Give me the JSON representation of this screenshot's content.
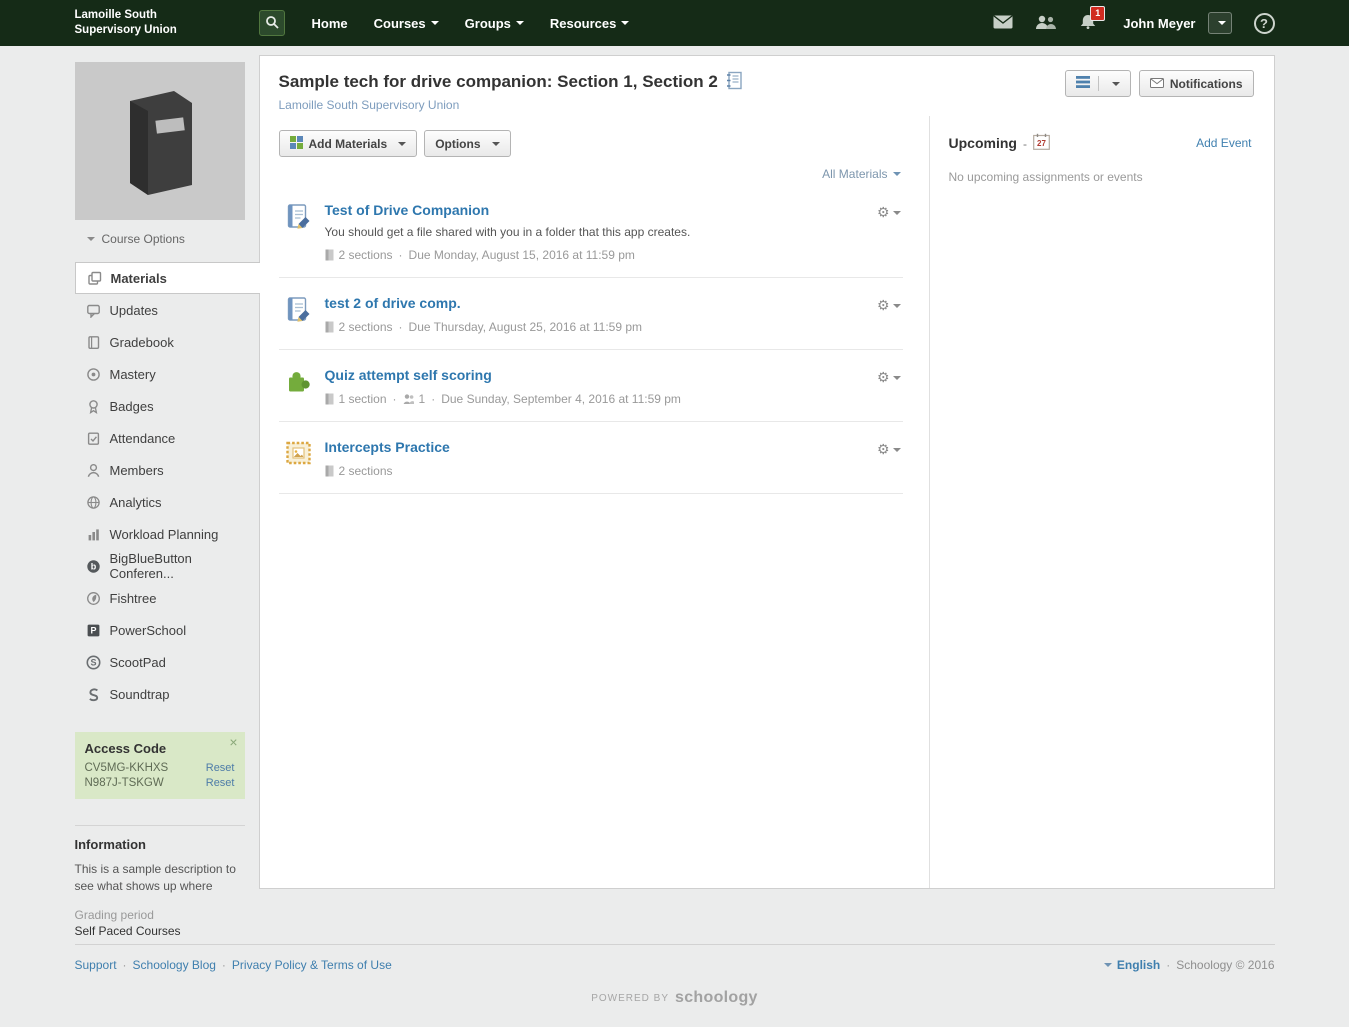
{
  "navbar": {
    "brand_line1": "Lamoille South",
    "brand_line2": "Supervisory Union",
    "links": [
      {
        "label": "Home"
      },
      {
        "label": "Courses"
      },
      {
        "label": "Groups"
      },
      {
        "label": "Resources"
      }
    ],
    "notification_count": "1",
    "user_name": "John Meyer"
  },
  "course_header": {
    "title": "Sample tech for drive companion: Section 1, Section 2",
    "school_link": "Lamoille South Supervisory Union",
    "notifications_label": "Notifications"
  },
  "sidebar": {
    "course_options_label": "Course Options",
    "items": [
      {
        "label": "Materials"
      },
      {
        "label": "Updates"
      },
      {
        "label": "Gradebook"
      },
      {
        "label": "Mastery"
      },
      {
        "label": "Badges"
      },
      {
        "label": "Attendance"
      },
      {
        "label": "Members"
      },
      {
        "label": "Analytics"
      },
      {
        "label": "Workload Planning"
      },
      {
        "label": "BigBlueButton Conferen..."
      },
      {
        "label": "Fishtree"
      },
      {
        "label": "PowerSchool"
      },
      {
        "label": "ScootPad"
      },
      {
        "label": "Soundtrap"
      }
    ],
    "access_code": {
      "title": "Access Code",
      "close_label": "×",
      "codes": [
        {
          "code": "CV5MG-KKHXS",
          "reset_label": "Reset"
        },
        {
          "code": "N987J-TSKGW",
          "reset_label": "Reset"
        }
      ]
    },
    "information": {
      "title": "Information",
      "description": "This is a sample description to see what shows up where",
      "grading_period_label": "Grading period",
      "grading_period_value": "Self Paced Courses"
    }
  },
  "toolbar": {
    "add_materials_label": "Add Materials",
    "options_label": "Options",
    "filter_label": "All Materials"
  },
  "materials": [
    {
      "title": "Test of Drive Companion",
      "description": "You should get a file shared with you in a folder that this app creates.",
      "sections": "2 sections",
      "due": "Due Monday, August 15, 2016 at 11:59 pm"
    },
    {
      "title": "test 2 of drive comp.",
      "sections": "2 sections",
      "due": "Due Thursday, August 25, 2016 at 11:59 pm"
    },
    {
      "title": "Quiz attempt self scoring",
      "sections": "1 section",
      "people_count": "1",
      "due": "Due Sunday, September 4, 2016 at 11:59 pm"
    },
    {
      "title": "Intercepts Practice",
      "sections": "2 sections"
    }
  ],
  "upcoming": {
    "title": "Upcoming",
    "calendar_day": "27",
    "add_event_label": "Add Event",
    "empty_message": "No upcoming assignments or events"
  },
  "footer": {
    "links": [
      {
        "label": "Support"
      },
      {
        "label": "Schoology Blog"
      },
      {
        "label": "Privacy Policy & Terms of Use"
      }
    ],
    "language": "English",
    "copyright": "Schoology © 2016",
    "powered_by_label": "POWERED BY",
    "powered_by_brand": "schoology"
  },
  "colors": {
    "navbar_bg": "#152b17",
    "link_blue": "#2e77ae",
    "accent_green": "#74ac3c",
    "badge_red": "#d02b20",
    "access_code_bg": "#d9e8c7"
  }
}
